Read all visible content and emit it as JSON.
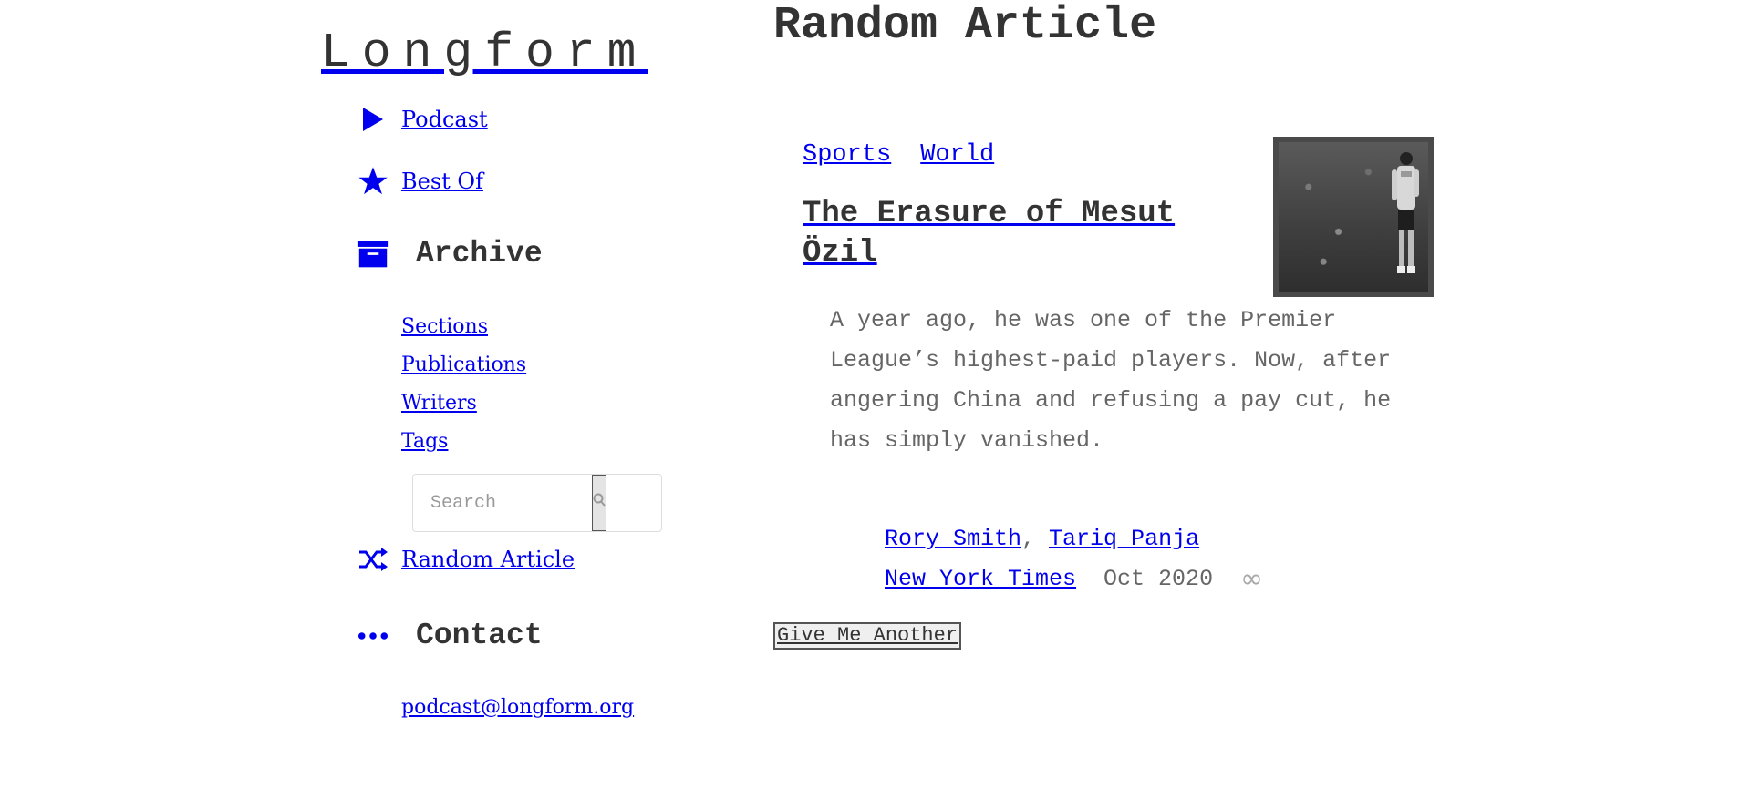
{
  "site": {
    "logo": "Longform"
  },
  "sidebar": {
    "podcast": "Podcast",
    "best_of": "Best Of",
    "archive_heading": "Archive",
    "archive_links": [
      "Sections",
      "Publications",
      "Writers",
      "Tags"
    ],
    "search_placeholder": "Search",
    "random_article": "Random Article",
    "contact_heading": "Contact",
    "contact_email": "podcast@longform.org"
  },
  "main": {
    "page_title": "Random Article",
    "article": {
      "tags": [
        "Sports",
        "World"
      ],
      "title": "The Erasure of Mesut Özil",
      "summary": "A year ago, he was one of the Premier League’s highest-paid players. Now, after angering China and refusing a pay cut, he has simply vanished.",
      "authors": [
        "Rory Smith",
        "Tariq Panja"
      ],
      "author_separator": ", ",
      "publication": "New York Times",
      "date": "Oct 2020",
      "permalink_symbol": "∞"
    },
    "another_button": "Give Me Another"
  },
  "colors": {
    "link": "#0000ee",
    "text": "#333333",
    "muted": "#666666"
  },
  "icons": {
    "podcast": "play-icon",
    "best_of": "star-icon",
    "archive": "archive-box-icon",
    "search": "magnifier-icon",
    "random": "shuffle-icon",
    "contact": "ellipsis-icon"
  }
}
